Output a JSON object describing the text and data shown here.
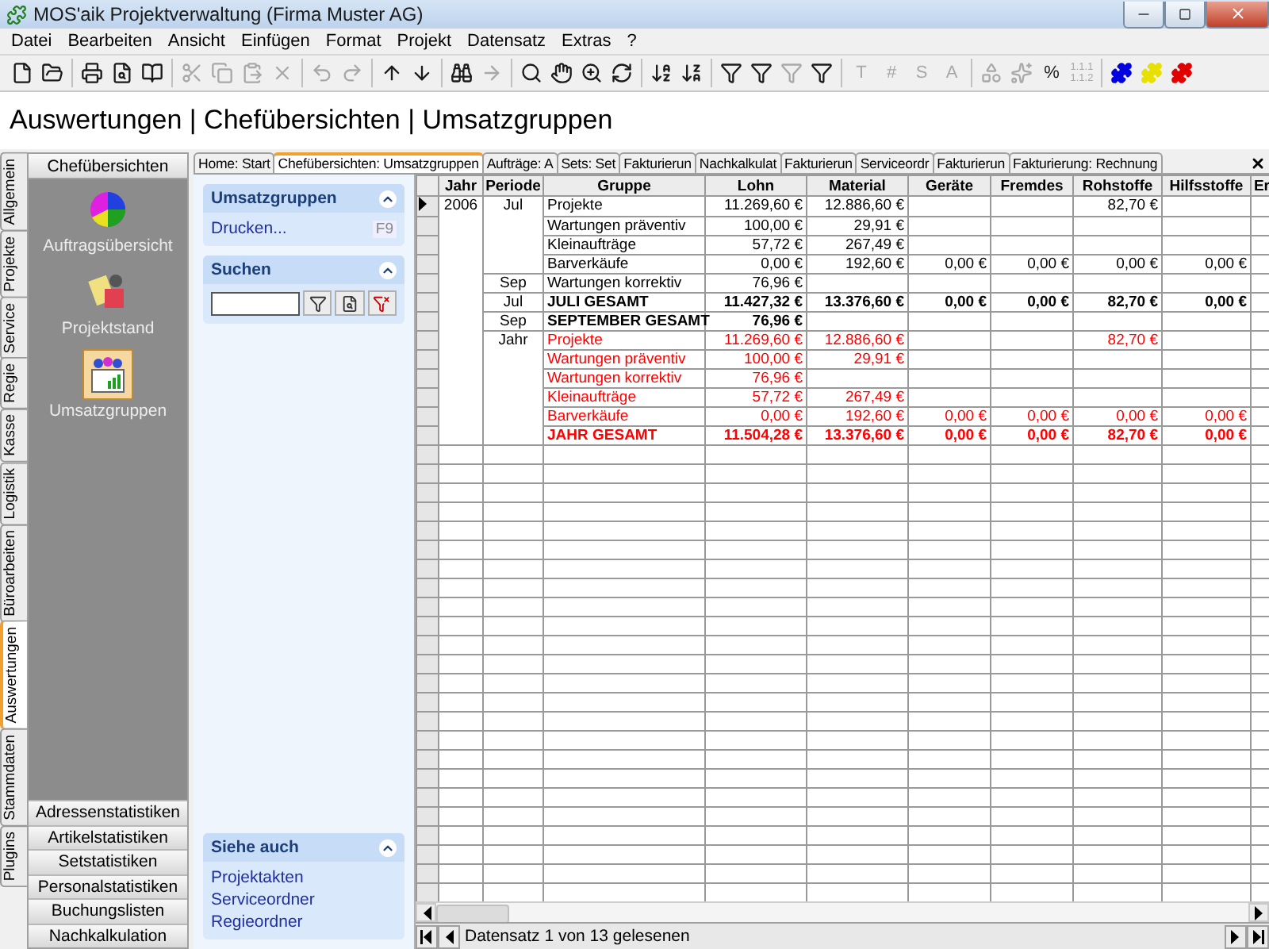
{
  "window": {
    "title": "MOS'aik Projektverwaltung (Firma Muster AG)"
  },
  "menu": [
    "Datei",
    "Bearbeiten",
    "Ansicht",
    "Einfügen",
    "Format",
    "Projekt",
    "Datensatz",
    "Extras",
    "?"
  ],
  "toolbar": [
    [
      {
        "kind": "icon",
        "disabled": false
      },
      {
        "kind": "icon",
        "disabled": false
      }
    ],
    [
      {
        "kind": "icon",
        "disabled": false
      },
      {
        "kind": "icon",
        "disabled": false
      },
      {
        "kind": "icon",
        "disabled": false
      }
    ],
    [
      {
        "kind": "icon",
        "disabled": true
      },
      {
        "kind": "icon",
        "disabled": true
      },
      {
        "kind": "icon",
        "disabled": true
      },
      {
        "kind": "icon",
        "disabled": true
      }
    ],
    [
      {
        "kind": "icon",
        "disabled": true
      },
      {
        "kind": "icon",
        "disabled": true
      }
    ],
    [
      {
        "kind": "icon",
        "disabled": false
      },
      {
        "kind": "icon",
        "disabled": false
      }
    ],
    [
      {
        "kind": "icon",
        "disabled": false
      },
      {
        "kind": "icon",
        "disabled": true
      }
    ],
    [
      {
        "kind": "icon",
        "disabled": false
      },
      {
        "kind": "icon",
        "disabled": false
      },
      {
        "kind": "icon",
        "disabled": false
      },
      {
        "kind": "icon",
        "disabled": false
      }
    ],
    [
      {
        "kind": "icon",
        "disabled": false
      },
      {
        "kind": "icon",
        "disabled": false
      }
    ],
    [
      {
        "kind": "icon",
        "disabled": false
      },
      {
        "kind": "icon",
        "disabled": false
      },
      {
        "kind": "icon",
        "disabled": true
      },
      {
        "kind": "icon",
        "disabled": false
      }
    ],
    [
      {
        "kind": "glyph",
        "text": "T",
        "disabled": true
      },
      {
        "kind": "glyph",
        "text": "#",
        "disabled": true
      },
      {
        "kind": "glyph",
        "text": "S",
        "disabled": true
      },
      {
        "kind": "glyph",
        "text": "A",
        "disabled": true
      }
    ],
    [
      {
        "kind": "icon",
        "disabled": true
      },
      {
        "kind": "icon",
        "disabled": true
      },
      {
        "kind": "glyph",
        "text": "%",
        "disabled": false
      },
      {
        "kind": "stack",
        "lines": [
          "1.1.1",
          "1.1.2"
        ],
        "disabled": true
      }
    ],
    [
      {
        "kind": "icon",
        "disabled": false,
        "color": "#0000e0"
      },
      {
        "kind": "icon",
        "disabled": false,
        "color": "#e8e000"
      },
      {
        "kind": "icon",
        "disabled": false,
        "color": "#e00000"
      }
    ]
  ],
  "breadcrumb": "Auswertungen | Chefübersichten | Umsatzgruppen",
  "side_tabs": [
    {
      "label": "Allgemein",
      "selected": false
    },
    {
      "label": "Projekte",
      "selected": false
    },
    {
      "label": "Service",
      "selected": false
    },
    {
      "label": "Regie",
      "selected": false
    },
    {
      "label": "Kasse",
      "selected": false
    },
    {
      "label": "Logistik",
      "selected": false
    },
    {
      "label": "Büroarbeiten",
      "selected": false
    },
    {
      "label": "Auswertungen",
      "selected": true
    },
    {
      "label": "Stammdaten",
      "selected": false
    },
    {
      "label": "Plugins",
      "selected": false
    }
  ],
  "navigator": {
    "title": "Chefübersichten",
    "items": [
      {
        "label": "Auftragsübersicht",
        "selected": false
      },
      {
        "label": "Projektstand",
        "selected": false
      },
      {
        "label": "Umsatzgruppen",
        "selected": true
      }
    ],
    "groups": [
      "Adressenstatistiken",
      "Artikelstatistiken",
      "Setstatistiken",
      "Personalstatistiken",
      "Buchungslisten",
      "Nachkalkulation"
    ]
  },
  "doc_tabs": [
    {
      "label": "Home: Start",
      "selected": false
    },
    {
      "label": "Chefübersichten: Umsatzgruppen",
      "selected": true
    },
    {
      "label": "Aufträge: A",
      "selected": false
    },
    {
      "label": "Sets: Set",
      "selected": false
    },
    {
      "label": "Fakturierun",
      "selected": false
    },
    {
      "label": "Nachkalkulat",
      "selected": false
    },
    {
      "label": "Fakturierun",
      "selected": false
    },
    {
      "label": "Serviceordr",
      "selected": false
    },
    {
      "label": "Fakturierun",
      "selected": false
    },
    {
      "label": "Fakturierung: Rechnung",
      "selected": false
    }
  ],
  "tasks": {
    "sections": [
      {
        "kind": "links",
        "title": "Umsatzgruppen",
        "expanded": true,
        "links": [
          {
            "label": "Drucken...",
            "shortcut": "F9"
          }
        ]
      },
      {
        "kind": "search",
        "title": "Suchen",
        "expanded": true
      }
    ],
    "see_also": {
      "title": "Siehe auch",
      "expanded": true,
      "links": [
        "Projektakten",
        "Serviceordner",
        "Regieordner"
      ]
    }
  },
  "table": {
    "columns": [
      "Jahr",
      "Periode",
      "Gruppe",
      "Lohn",
      "Material",
      "Geräte",
      "Fremdes",
      "Rohstoffe",
      "Hilfsstoffe",
      "Er"
    ],
    "rows": [
      {
        "kind": "item",
        "selected": true,
        "jahr": "2006",
        "periode": "Jul",
        "gruppe": "Projekte",
        "lohn": "11.269,60 €",
        "material": "12.886,60 €",
        "rohstoffe": "82,70 €"
      },
      {
        "kind": "item",
        "selected": false,
        "gruppe": "Wartungen präventiv",
        "lohn": "100,00 €",
        "material": "29,91 €"
      },
      {
        "kind": "item",
        "selected": false,
        "gruppe": "Kleinaufträge",
        "lohn": "57,72 €",
        "material": "267,49 €"
      },
      {
        "kind": "item",
        "selected": false,
        "gruppe": "Barverkäufe",
        "lohn": "0,00 €",
        "material": "192,60 €",
        "geraete": "0,00 €",
        "fremdes": "0,00 €",
        "rohstoffe": "0,00 €",
        "hilfsstoffe": "0,00 €"
      },
      {
        "kind": "item",
        "selected": false,
        "periode": "Sep",
        "gruppe": "Wartungen korrektiv",
        "lohn": "76,96 €"
      },
      {
        "kind": "total",
        "selected": false,
        "periode": "Jul",
        "gruppe": "JULI GESAMT",
        "lohn": "11.427,32 €",
        "material": "13.376,60 €",
        "geraete": "0,00 €",
        "fremdes": "0,00 €",
        "rohstoffe": "82,70 €",
        "hilfsstoffe": "0,00 €"
      },
      {
        "kind": "total",
        "selected": false,
        "periode": "Sep",
        "gruppe": "SEPTEMBER GESAMT",
        "lohn": "76,96 €"
      },
      {
        "kind": "year_item",
        "selected": false,
        "periode": "Jahr",
        "gruppe": "Projekte",
        "lohn": "11.269,60 €",
        "material": "12.886,60 €",
        "rohstoffe": "82,70 €"
      },
      {
        "kind": "year_item",
        "selected": false,
        "gruppe": "Wartungen präventiv",
        "lohn": "100,00 €",
        "material": "29,91 €"
      },
      {
        "kind": "year_item",
        "selected": false,
        "gruppe": "Wartungen korrektiv",
        "lohn": "76,96 €"
      },
      {
        "kind": "year_item",
        "selected": false,
        "gruppe": "Kleinaufträge",
        "lohn": "57,72 €",
        "material": "267,49 €"
      },
      {
        "kind": "year_item",
        "selected": false,
        "gruppe": "Barverkäufe",
        "lohn": "0,00 €",
        "material": "192,60 €",
        "geraete": "0,00 €",
        "fremdes": "0,00 €",
        "rohstoffe": "0,00 €",
        "hilfsstoffe": "0,00 €"
      },
      {
        "kind": "year_total",
        "selected": false,
        "gruppe": "JAHR GESAMT",
        "lohn": "11.504,28 €",
        "material": "13.376,60 €",
        "geraete": "0,00 €",
        "fremdes": "0,00 €",
        "rohstoffe": "82,70 €",
        "hilfsstoffe": "0,00 €"
      }
    ]
  },
  "record_bar": {
    "text": "Datensatz 1 von 13 gelesenen"
  }
}
